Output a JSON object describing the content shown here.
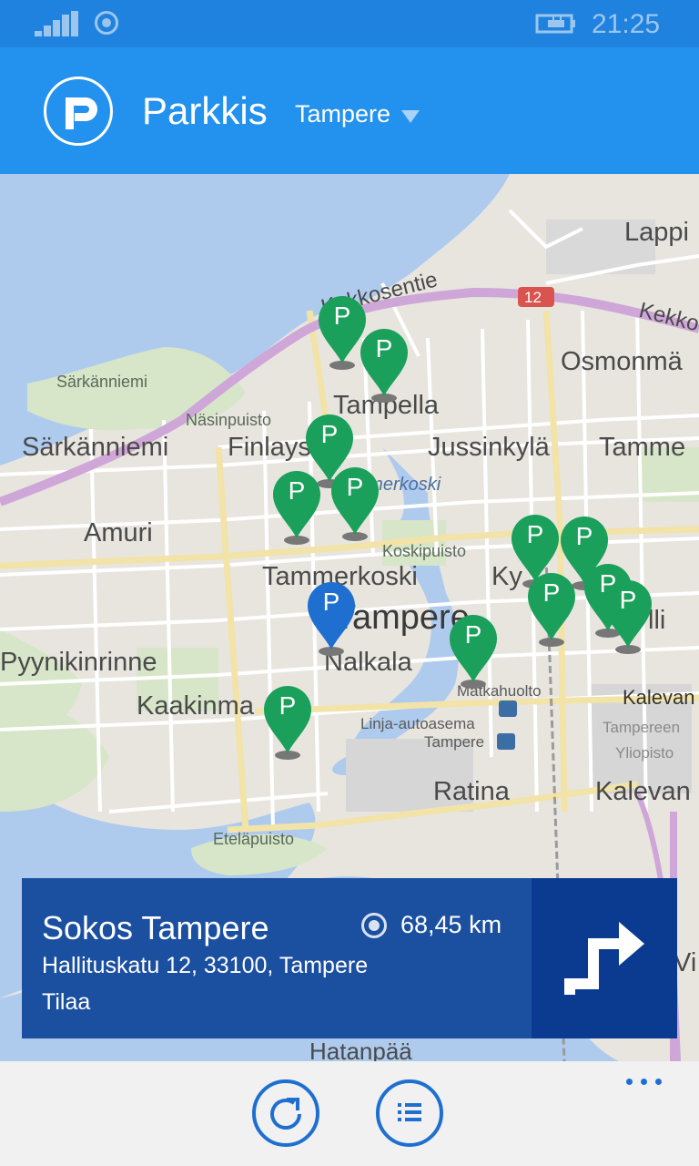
{
  "status": {
    "time": "21:25"
  },
  "header": {
    "app_title": "Parkkis",
    "city": "Tampere",
    "logo_letter": "P"
  },
  "map": {
    "road_sign": "12",
    "labels": {
      "lappi": "Lappi",
      "kekkosentie": "Kekkosentie",
      "kekko": "Kekko",
      "osmonmaki": "Osmonmä",
      "sarkanniemi_park": "Särkänniemi",
      "nasinpuisto": "Näsinpuisto",
      "tampella": "Tampella",
      "sarkanniemi": "Särkänniemi",
      "finlayson": "Finlays",
      "jussinkyla": "Jussinkylä",
      "tammela": "Tamme",
      "tammerkoski_river": "Tammerkoski",
      "amuri": "Amuri",
      "koskipuisto": "Koskipuisto",
      "tammerkoski": "Tammerkoski",
      "kyttala": "Ky",
      "tampere": "Tampere",
      "pyynikinrinne": "Pyynikinrinne",
      "nalkala": "Nalkala",
      "matkahuolto": "Matkahuolto",
      "kaakinmaa": "Kaakinma",
      "kalevantie": "Kalevan",
      "linja_autoasema": "Linja-autoasema",
      "linja_tampere": "Tampere",
      "tampereen": "Tampereen",
      "yliopisto": "Yliopisto",
      "ratina": "Ratina",
      "kaleva": "Kalevan",
      "etelapuisto": "Eteläpuisto",
      "hatanpaa": "Hatanpää",
      "lli": "lli",
      "vi": "Vi"
    },
    "marker_label": "P",
    "marker_colors": {
      "available": "#1aa05a",
      "selected": "#1f6fd0"
    }
  },
  "selected": {
    "name": "Sokos Tampere",
    "address": "Hallituskatu 12, 33100, Tampere",
    "status": "Tilaa",
    "distance": "68,45 km"
  },
  "appbar": {
    "icons": [
      "refresh-icon",
      "list-icon",
      "more-icon"
    ]
  },
  "colors": {
    "accent": "#2391ee",
    "card": "#1b4fa0",
    "card_dark": "#0b3b90"
  }
}
